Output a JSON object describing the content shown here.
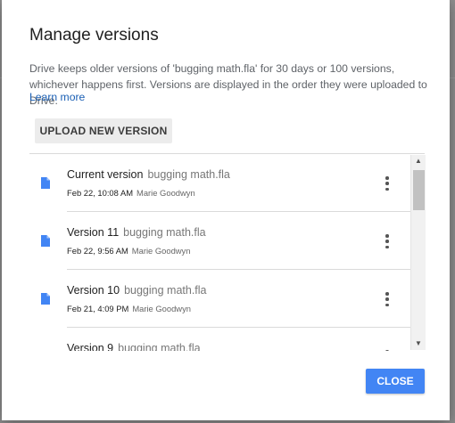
{
  "dialog": {
    "title": "Manage versions",
    "description": "Drive keeps older versions of 'bugging math.fla' for 30 days or 100 versions, whichever happens first. Versions are displayed in the order they were uploaded to Drive.",
    "learn_more": "Learn more",
    "upload_label": "UPLOAD NEW VERSION",
    "close_label": "CLOSE"
  },
  "versions": [
    {
      "label": "Current version",
      "file": "bugging math.fla",
      "date": "Feb 22, 10:08 AM",
      "author": "Marie Goodwyn"
    },
    {
      "label": "Version 11",
      "file": "bugging math.fla",
      "date": "Feb 22, 9:56 AM",
      "author": "Marie Goodwyn"
    },
    {
      "label": "Version 10",
      "file": "bugging math.fla",
      "date": "Feb 21, 4:09 PM",
      "author": "Marie Goodwyn"
    },
    {
      "label": "Version 9",
      "file": "bugging math.fla",
      "date": "",
      "author": ""
    }
  ],
  "scrollbar": {
    "up_glyph": "▲",
    "down_glyph": "▼"
  },
  "colors": {
    "accent": "#4285f4",
    "file_icon": "#4285f4",
    "link": "#1a5fb4"
  },
  "icons": {
    "file": "document-icon",
    "menu": "more-vert-icon"
  }
}
